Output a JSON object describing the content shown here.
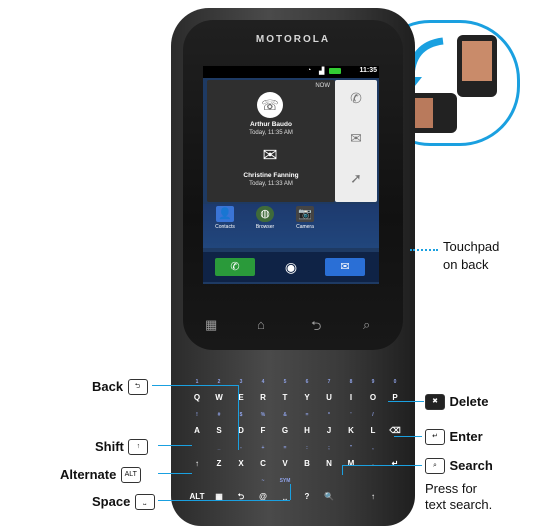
{
  "phone": {
    "brand": "MOTOROLA",
    "status_time": "11:35",
    "notification_panel": {
      "now": "NOW",
      "items": [
        {
          "name": "Arthur Baudo",
          "time": "Today, 11:35 AM"
        },
        {
          "name": "Christine Fanning",
          "time": "Today, 11:33 AM"
        }
      ]
    },
    "apps": [
      "Contacts",
      "Browser",
      "Camera"
    ],
    "keyboard": {
      "rows": [
        [
          {
            "k": "Q",
            "s": "1"
          },
          {
            "k": "W",
            "s": "2"
          },
          {
            "k": "E",
            "s": "3"
          },
          {
            "k": "R",
            "s": "4"
          },
          {
            "k": "T",
            "s": "5"
          },
          {
            "k": "Y",
            "s": "6"
          },
          {
            "k": "U",
            "s": "7"
          },
          {
            "k": "I",
            "s": "8"
          },
          {
            "k": "O",
            "s": "9"
          },
          {
            "k": "P",
            "s": "0"
          }
        ],
        [
          {
            "k": "A",
            "s": "!"
          },
          {
            "k": "S",
            "s": "#"
          },
          {
            "k": "D",
            "s": "$"
          },
          {
            "k": "F",
            "s": "%"
          },
          {
            "k": "G",
            "s": "&"
          },
          {
            "k": "H",
            "s": "="
          },
          {
            "k": "J",
            "s": "*"
          },
          {
            "k": "K",
            "s": "'"
          },
          {
            "k": "L",
            "s": "/"
          },
          {
            "k": "⌫",
            "s": ""
          }
        ],
        [
          {
            "k": "↑",
            "s": ""
          },
          {
            "k": "Z",
            "s": "_"
          },
          {
            "k": "X",
            "s": "-"
          },
          {
            "k": "C",
            "s": "+"
          },
          {
            "k": "V",
            "s": "="
          },
          {
            "k": "B",
            "s": ":"
          },
          {
            "k": "N",
            "s": ";"
          },
          {
            "k": "M",
            "s": "\""
          },
          {
            "k": ".",
            "s": ","
          },
          {
            "k": "↵",
            "s": ""
          }
        ],
        [
          {
            "k": "ALT",
            "s": ""
          },
          {
            "k": "▦",
            "s": ""
          },
          {
            "k": "⮌",
            "s": ""
          },
          {
            "k": "@",
            "s": "~"
          },
          {
            "k": "⎵",
            "s": "SYM"
          },
          {
            "k": "?",
            "s": ""
          },
          {
            "k": "🔍",
            "s": ""
          },
          {
            "k": "",
            "s": ""
          },
          {
            "k": "↑",
            "s": ""
          }
        ]
      ]
    }
  },
  "callouts": {
    "touchpad": "Touchpad",
    "touchpad_sub": "on back",
    "back": "Back",
    "shift": "Shift",
    "alternate": "Alternate",
    "alt_key": "ALT",
    "space": "Space",
    "delete": "Delete",
    "enter": "Enter",
    "search": "Search",
    "search_note_1": "Press for",
    "search_note_2": "text search."
  },
  "colors": {
    "callout_line": "#1aa0e0",
    "dock_green": "#2a9a3a",
    "dock_blue": "#2a6fd6"
  }
}
